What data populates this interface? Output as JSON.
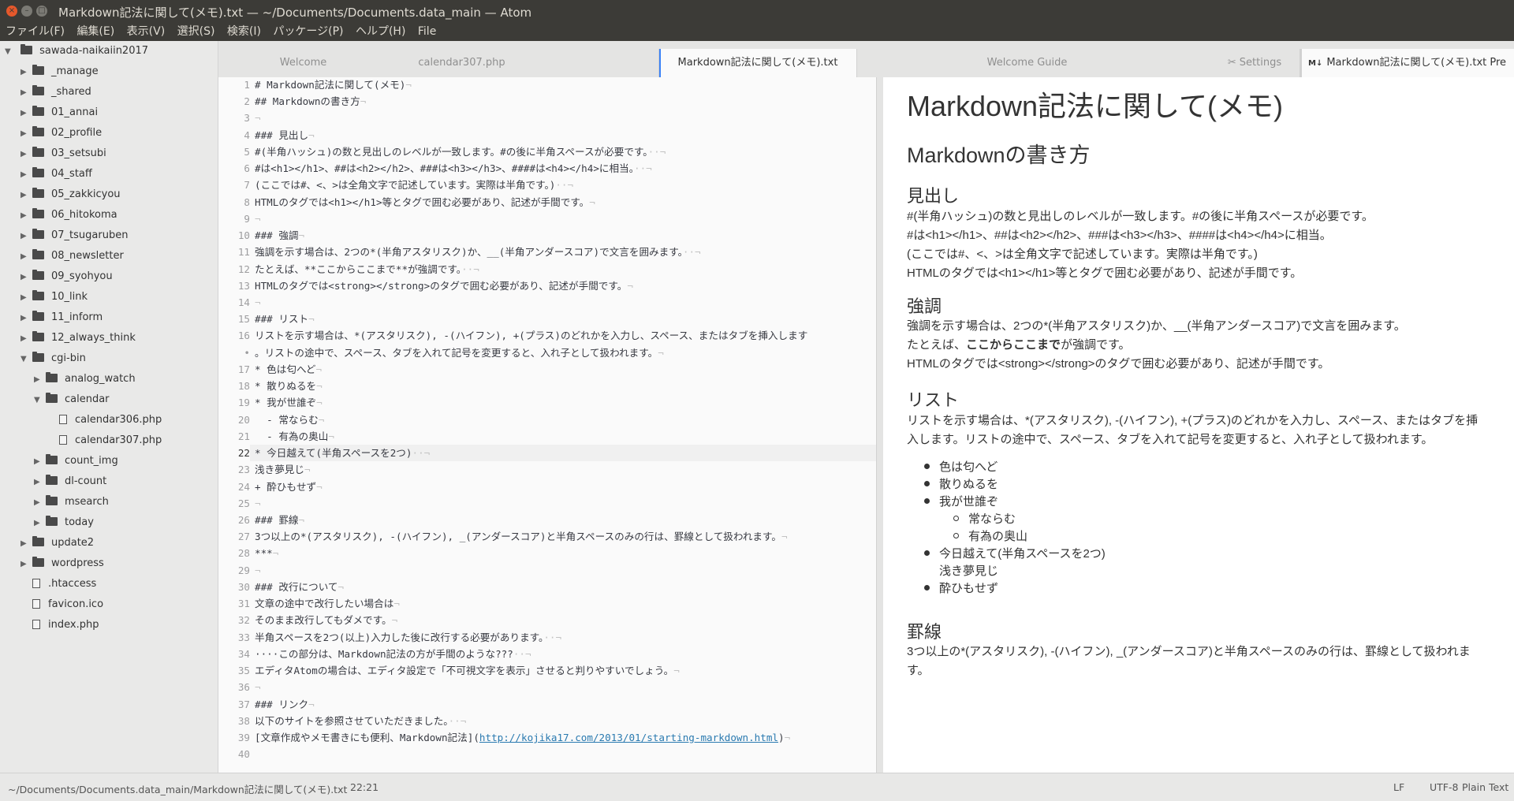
{
  "window": {
    "title": "Markdown記法に関して(メモ).txt — ~/Documents/Documents.data_main — Atom",
    "close_glyph": "×",
    "min_glyph": "–",
    "max_glyph": "□"
  },
  "menu": [
    "ファイル(F)",
    "編集(E)",
    "表示(V)",
    "選択(S)",
    "検索(I)",
    "パッケージ(P)",
    "ヘルプ(H)",
    "File"
  ],
  "tree": {
    "root": "sawada-naikaiin2017",
    "items": [
      {
        "label": "_manage",
        "kind": "folder",
        "level": 1,
        "expanded": false
      },
      {
        "label": "_shared",
        "kind": "folder",
        "level": 1,
        "expanded": false
      },
      {
        "label": "01_annai",
        "kind": "folder",
        "level": 1,
        "expanded": false
      },
      {
        "label": "02_profile",
        "kind": "folder",
        "level": 1,
        "expanded": false
      },
      {
        "label": "03_setsubi",
        "kind": "folder",
        "level": 1,
        "expanded": false
      },
      {
        "label": "04_staff",
        "kind": "folder",
        "level": 1,
        "expanded": false
      },
      {
        "label": "05_zakkicyou",
        "kind": "folder",
        "level": 1,
        "expanded": false
      },
      {
        "label": "06_hitokoma",
        "kind": "folder",
        "level": 1,
        "expanded": false
      },
      {
        "label": "07_tsugaruben",
        "kind": "folder",
        "level": 1,
        "expanded": false
      },
      {
        "label": "08_newsletter",
        "kind": "folder",
        "level": 1,
        "expanded": false
      },
      {
        "label": "09_syohyou",
        "kind": "folder",
        "level": 1,
        "expanded": false
      },
      {
        "label": "10_link",
        "kind": "folder",
        "level": 1,
        "expanded": false
      },
      {
        "label": "11_inform",
        "kind": "folder",
        "level": 1,
        "expanded": false
      },
      {
        "label": "12_always_think",
        "kind": "folder",
        "level": 1,
        "expanded": false
      },
      {
        "label": "cgi-bin",
        "kind": "folder",
        "level": 1,
        "expanded": true
      },
      {
        "label": "analog_watch",
        "kind": "folder",
        "level": 2,
        "expanded": false
      },
      {
        "label": "calendar",
        "kind": "folder",
        "level": 2,
        "expanded": true
      },
      {
        "label": "calendar306.php",
        "kind": "file",
        "level": 3
      },
      {
        "label": "calendar307.php",
        "kind": "file",
        "level": 3
      },
      {
        "label": "count_img",
        "kind": "folder",
        "level": 2,
        "expanded": false
      },
      {
        "label": "dl-count",
        "kind": "folder",
        "level": 2,
        "expanded": false
      },
      {
        "label": "msearch",
        "kind": "folder",
        "level": 2,
        "expanded": false
      },
      {
        "label": "today",
        "kind": "folder",
        "level": 2,
        "expanded": false
      },
      {
        "label": "update2",
        "kind": "folder",
        "level": 1,
        "expanded": false
      },
      {
        "label": "wordpress",
        "kind": "folder",
        "level": 1,
        "expanded": false
      },
      {
        "label": ".htaccess",
        "kind": "file",
        "level": 1
      },
      {
        "label": "favicon.ico",
        "kind": "file",
        "level": 1
      },
      {
        "label": "index.php",
        "kind": "file",
        "level": 1
      }
    ]
  },
  "tabs_left": [
    {
      "label": "Welcome",
      "active": false
    },
    {
      "label": "calendar307.php",
      "active": false
    },
    {
      "label": "Markdown記法に関して(メモ).txt",
      "active": true
    }
  ],
  "tabs_right": [
    {
      "label": "Welcome Guide",
      "active": false,
      "icon": ""
    },
    {
      "label": "Settings",
      "active": false,
      "icon": "✂"
    },
    {
      "label": "Markdown記法に関して(メモ).txt Pre",
      "active": true,
      "icon": "M↓"
    }
  ],
  "editor": {
    "cursor_row": 22,
    "lines": [
      {
        "n": "1",
        "t": "# Markdown記法に関して(メモ)",
        "inv": "¬"
      },
      {
        "n": "2",
        "t": "## Markdownの書き方",
        "inv": "¬"
      },
      {
        "n": "3",
        "t": "",
        "inv": "¬"
      },
      {
        "n": "4",
        "t": "### 見出し",
        "inv": "¬"
      },
      {
        "n": "5",
        "t": "#(半角ハッシュ)の数と見出しのレベルが一致します。#の後に半角スペースが必要です。",
        "inv": "··¬"
      },
      {
        "n": "6",
        "t": "#は<h1></h1>、##は<h2></h2>、###は<h3></h3>、####は<h4></h4>に相当。",
        "inv": "··¬"
      },
      {
        "n": "7",
        "t": "(ここでは#、<、>は全角文字で記述しています。実際は半角です。)",
        "inv": "··¬"
      },
      {
        "n": "8",
        "t": "HTMLのタグでは<h1></h1>等とタグで囲む必要があり、記述が手間です。",
        "inv": "¬"
      },
      {
        "n": "9",
        "t": "",
        "inv": "¬"
      },
      {
        "n": "10",
        "t": "### 強調",
        "inv": "¬"
      },
      {
        "n": "11",
        "t": "強調を示す場合は、2つの*(半角アスタリスク)か、__(半角アンダースコア)で文言を囲みます。",
        "inv": "··¬"
      },
      {
        "n": "12",
        "t": "たとえば、**ここからここまで**が強調です。",
        "inv": "··¬"
      },
      {
        "n": "13",
        "t": "HTMLのタグでは<strong></strong>のタグで囲む必要があり、記述が手間です。",
        "inv": "¬"
      },
      {
        "n": "14",
        "t": "",
        "inv": "¬"
      },
      {
        "n": "15",
        "t": "### リスト",
        "inv": "¬"
      },
      {
        "n": "16",
        "t": "リストを示す場合は、*(アスタリスク), -(ハイフン), +(プラス)のどれかを入力し、スペース、またはタブを挿入します",
        "inv": ""
      },
      {
        "n": "•",
        "t": "。リストの途中で、スペース、タブを入れて記号を変更すると、入れ子として扱われます。",
        "inv": "¬"
      },
      {
        "n": "17",
        "t": "* 色は匂へど",
        "inv": "¬"
      },
      {
        "n": "18",
        "t": "* 散りぬるを",
        "inv": "¬"
      },
      {
        "n": "19",
        "t": "* 我が世誰ぞ",
        "inv": "¬"
      },
      {
        "n": "20",
        "t": "  - 常ならむ",
        "inv": "¬"
      },
      {
        "n": "21",
        "t": "  - 有為の奥山",
        "inv": "¬"
      },
      {
        "n": "22",
        "t": "* 今日越えて(半角スペースを2つ)",
        "inv": "··¬"
      },
      {
        "n": "23",
        "t": "浅き夢見じ",
        "inv": "¬"
      },
      {
        "n": "24",
        "t": "+ 酔ひもせず",
        "inv": "¬"
      },
      {
        "n": "25",
        "t": "",
        "inv": "¬"
      },
      {
        "n": "26",
        "t": "### 罫線",
        "inv": "¬"
      },
      {
        "n": "27",
        "t": "3つ以上の*(アスタリスク), -(ハイフン), _(アンダースコア)と半角スペースのみの行は、罫線として扱われます。",
        "inv": "¬"
      },
      {
        "n": "28",
        "t": "***",
        "inv": "¬"
      },
      {
        "n": "29",
        "t": "",
        "inv": "¬"
      },
      {
        "n": "30",
        "t": "### 改行について",
        "inv": "¬"
      },
      {
        "n": "31",
        "t": "文章の途中で改行したい場合は",
        "inv": "¬"
      },
      {
        "n": "32",
        "t": "そのまま改行してもダメです。",
        "inv": "¬"
      },
      {
        "n": "33",
        "t": "半角スペースを2つ(以上)入力した後に改行する必要があります。",
        "inv": "··¬"
      },
      {
        "n": "34",
        "t": "····この部分は、Markdown記法の方が手間のような???",
        "inv": "··¬"
      },
      {
        "n": "35",
        "t": "エディタAtomの場合は、エディタ設定で「不可視文字を表示」させると判りやすいでしょう。",
        "inv": "¬"
      },
      {
        "n": "36",
        "t": "",
        "inv": "¬"
      },
      {
        "n": "37",
        "t": "### リンク",
        "inv": "¬"
      },
      {
        "n": "38",
        "t": "以下のサイトを参照させていただきました。",
        "inv": "··¬"
      },
      {
        "n": "39",
        "t": "[文章作成やメモ書きにも便利、Markdown記法](",
        "link": "http://kojika17.com/2013/01/starting-markdown.html",
        "after": ")",
        "inv": "¬"
      },
      {
        "n": "40",
        "t": "",
        "inv": ""
      }
    ]
  },
  "preview": {
    "h1": "Markdown記法に関して(メモ)",
    "h2": "Markdownの書き方",
    "s1_title": "見出し",
    "s1_lines": [
      "#(半角ハッシュ)の数と見出しのレベルが一致します。#の後に半角スペースが必要です。",
      "#は<h1></h1>、##は<h2></h2>、###は<h3></h3>、####は<h4></h4>に相当。",
      "(ここでは#、<、>は全角文字で記述しています。実際は半角です。)",
      "HTMLのタグでは<h1></h1>等とタグで囲む必要があり、記述が手間です。"
    ],
    "s2_title": "強調",
    "s2_line1": "強調を示す場合は、2つの*(半角アスタリスク)か、__(半角アンダースコア)で文言を囲みます。",
    "s2_line2_pre": "たとえば、",
    "s2_line2_bold": "ここからここまで",
    "s2_line2_post": "が強調です。",
    "s2_line3": "HTMLのタグでは<strong></strong>のタグで囲む必要があり、記述が手間です。",
    "s3_title": "リスト",
    "s3_para": "リストを示す場合は、*(アスタリスク), -(ハイフン), +(プラス)のどれかを入力し、スペース、またはタブを挿入します。リストの途中で、スペース、タブを入れて記号を変更すると、入れ子として扱われます。",
    "list": [
      "色は匂へど",
      "散りぬるを",
      "我が世誰ぞ"
    ],
    "sublist": [
      "常ならむ",
      "有為の奥山"
    ],
    "list_after1": "今日越えて(半角スペースを2つ)",
    "list_after1_cont": "浅き夢見じ",
    "list_after2": "酔ひもせず",
    "s4_title": "罫線",
    "s4_para": "3つ以上の*(アスタリスク), -(ハイフン), _(アンダースコア)と半角スペースのみの行は、罫線として扱われます。"
  },
  "status": {
    "path": "~/Documents/Documents.data_main/Markdown記法に関して(メモ).txt",
    "position": "22:21",
    "line_ending": "LF",
    "encoding": "UTF-8",
    "grammar": "Plain Text"
  },
  "colors": {
    "accent": "#3b82f6",
    "link": "#2a7ab0",
    "titlebar": "#3c3b37"
  }
}
